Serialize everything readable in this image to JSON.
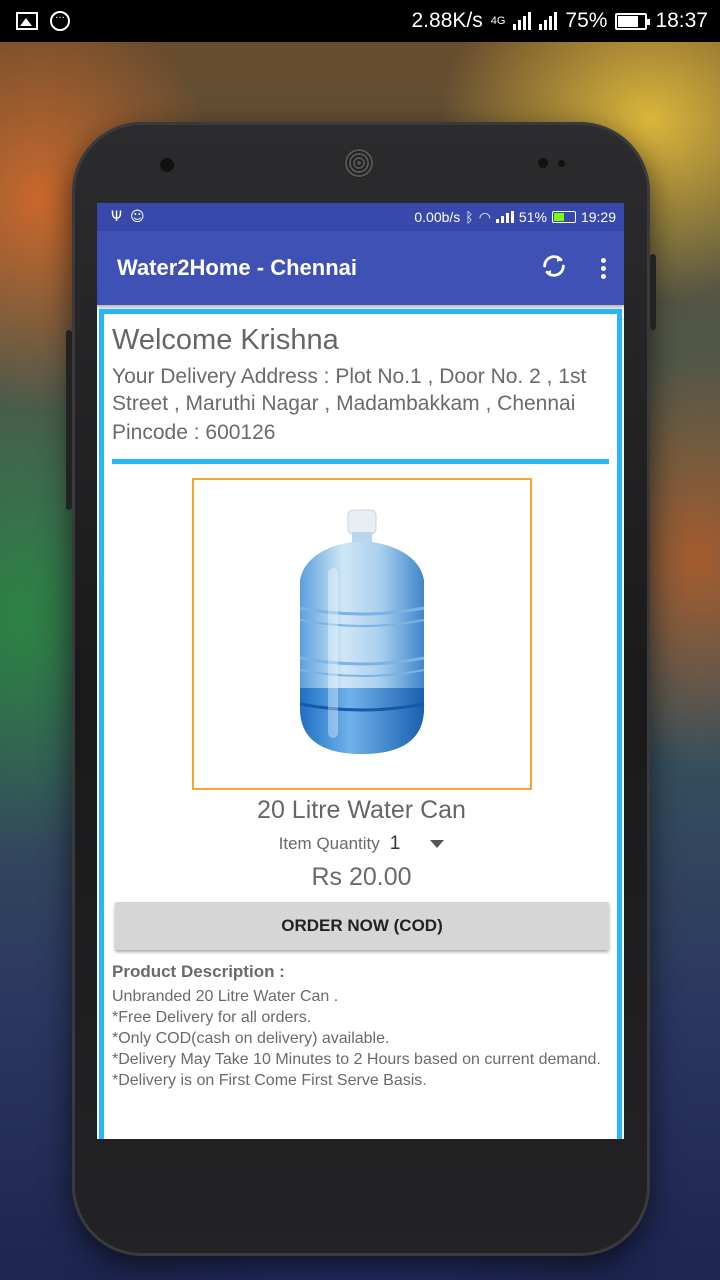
{
  "os_status": {
    "net_speed": "2.88K/s",
    "network_type": "4G",
    "battery": "75%",
    "battery_level": 0.75,
    "time": "18:37"
  },
  "app_status": {
    "net_speed": "0.00b/s",
    "battery": "51%",
    "battery_level": 0.51,
    "time": "19:29"
  },
  "toolbar": {
    "title": "Water2Home - Chennai",
    "refresh_icon": "refresh-icon",
    "menu_icon": "more-vert-icon"
  },
  "user": {
    "welcome": "Welcome Krishna",
    "address": "Your Delivery Address : Plot No.1 , Door No. 2 , 1st Street , Maruthi Nagar , Madambakkam , Chennai",
    "pincode": "Pincode : 600126"
  },
  "product": {
    "name": "20 Litre Water Can",
    "quantity_label": "Item Quantity",
    "quantity_value": "1",
    "price": "Rs 20.00",
    "order_button": "ORDER NOW (COD)",
    "description_title": "Product Description :",
    "description_lines": [
      "Unbranded 20 Litre Water Can .",
      "*Free Delivery for all orders.",
      "*Only COD(cash on delivery) available.",
      "*Delivery May Take 10 Minutes to 2 Hours based on current demand.",
      "*Delivery is on First Come First Serve Basis."
    ]
  },
  "colors": {
    "toolbar": "#3f51b5",
    "status_bar": "#3949ab",
    "accent_border": "#29b6f6",
    "image_frame": "#f0a830"
  }
}
